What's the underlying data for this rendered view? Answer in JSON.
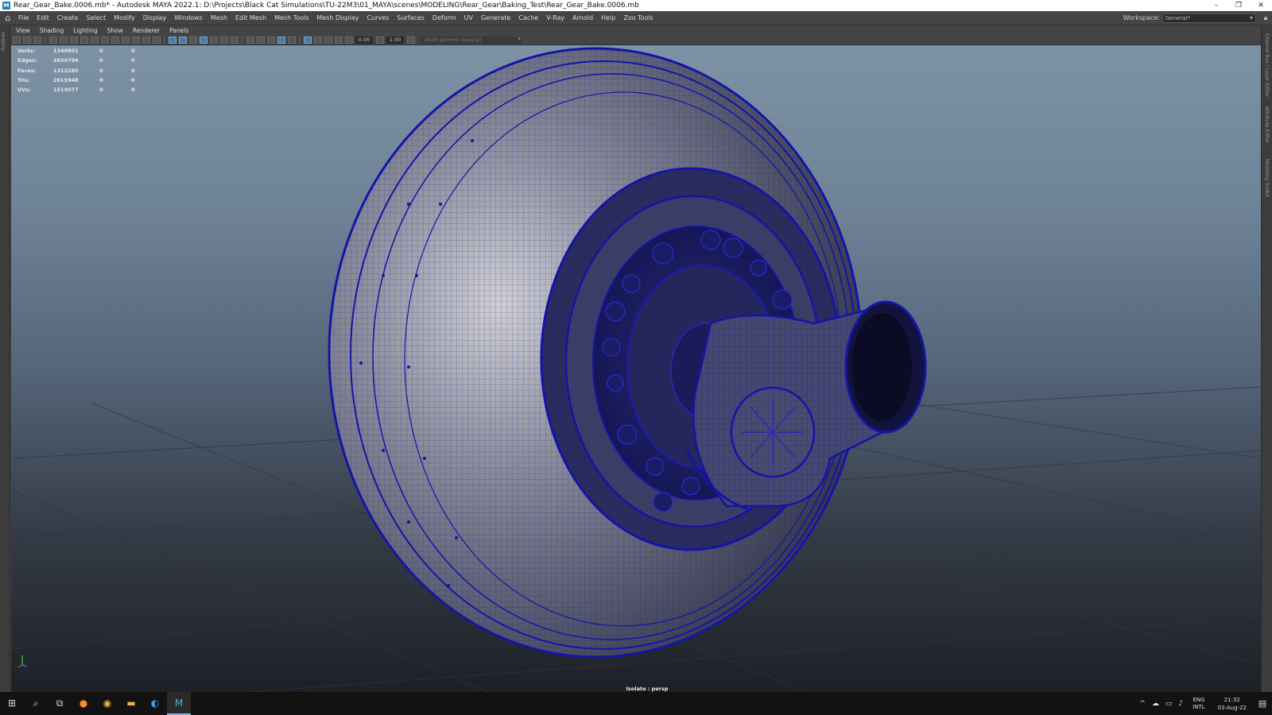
{
  "window": {
    "title": "Rear_Gear_Bake.0006.mb* - Autodesk MAYA 2022.1: D:\\Projects\\Black Cat Simulations\\TU-22M3\\01_MAYA\\scenes\\MODELING\\Rear_Gear\\Baking_Test\\Rear_Gear_Bake.0006.mb",
    "app_icon": "M",
    "minimize": "–",
    "restore": "❐",
    "close": "✕"
  },
  "menubar": {
    "items": [
      "File",
      "Edit",
      "Create",
      "Select",
      "Modify",
      "Display",
      "Windows",
      "Mesh",
      "Edit Mesh",
      "Mesh Tools",
      "Mesh Display",
      "Curves",
      "Surfaces",
      "Deform",
      "UV",
      "Generate",
      "Cache",
      "V-Ray",
      "Arnold",
      "Help",
      "Zoo Tools"
    ],
    "workspace_label": "Workspace:",
    "workspace_value": "General*"
  },
  "side_labels": {
    "left": "Outliner",
    "right": [
      "Channel Box / Layer Editor",
      "Attribute Editor",
      "Modeling Toolkit"
    ]
  },
  "panel_menu": [
    "View",
    "Shading",
    "Lighting",
    "Show",
    "Renderer",
    "Panels"
  ],
  "panel_toolbar": {
    "field1": "0.00",
    "field2": "1.00",
    "colorspace": "sRGB gamma (legacy)"
  },
  "hud": {
    "rows": [
      {
        "label": "Verts:",
        "v1": "1340851",
        "v2": "0",
        "v3": "0"
      },
      {
        "label": "Edges:",
        "v1": "2650794",
        "v2": "0",
        "v3": "0"
      },
      {
        "label": "Faces:",
        "v1": "1312280",
        "v2": "0",
        "v3": "0"
      },
      {
        "label": "Tris:",
        "v1": "2615948",
        "v2": "0",
        "v3": "0"
      },
      {
        "label": "UVs:",
        "v1": "1519077",
        "v2": "0",
        "v3": "0"
      }
    ]
  },
  "camera_label": "Isolate : persp",
  "taskbar": {
    "icons": [
      "windows-start-icon",
      "search-icon",
      "task-view-icon",
      "firefox-icon",
      "chrome-icon",
      "file-explorer-icon",
      "edge-icon",
      "maya-icon"
    ],
    "lang_top": "ENG",
    "lang_bottom": "INTL",
    "time": "21:32",
    "date": "03-Aug-22"
  },
  "colors": {
    "wire": "#1414a8",
    "tire_light": "#c9c9cc",
    "tire_dark": "#3a3c48"
  }
}
